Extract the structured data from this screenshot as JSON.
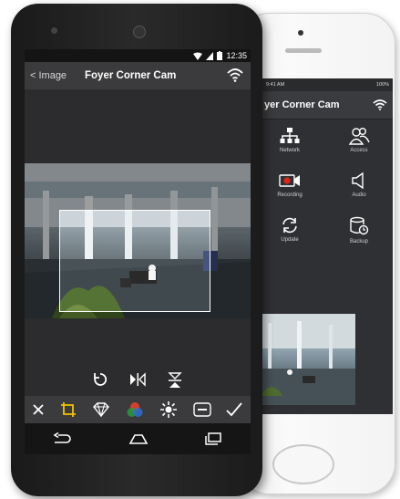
{
  "android": {
    "status": {
      "time": "12:35"
    },
    "header": {
      "back_label": "< Image",
      "title": "Foyer Corner Cam",
      "wifi_icon": "wifi-icon"
    },
    "transform_tools": [
      "rotate-icon",
      "flip-horizontal-icon",
      "flip-vertical-icon"
    ],
    "edit_tools": [
      "close-icon",
      "crop-icon",
      "gem-icon",
      "color-icon",
      "brightness-icon",
      "hdr-icon",
      "check-icon"
    ],
    "nav": [
      "back-icon",
      "home-icon",
      "recents-icon"
    ],
    "colors": {
      "accent": "#f2c200",
      "background": "#2c2c2e",
      "toolbar": "#3b3b3d"
    }
  },
  "iphone": {
    "status": {
      "time": "9:41 AM",
      "battery": "100%"
    },
    "header": {
      "title": "yer Corner Cam"
    },
    "grid": [
      {
        "label": "Network",
        "icon": "network-icon"
      },
      {
        "label": "Access",
        "icon": "users-icon"
      },
      {
        "label": "Recording",
        "icon": "video-record-icon"
      },
      {
        "label": "Audio",
        "icon": "speaker-icon"
      },
      {
        "label": "Update",
        "icon": "refresh-icon"
      },
      {
        "label": "Backup",
        "icon": "backup-icon"
      }
    ],
    "page_dots": "●○○○"
  }
}
